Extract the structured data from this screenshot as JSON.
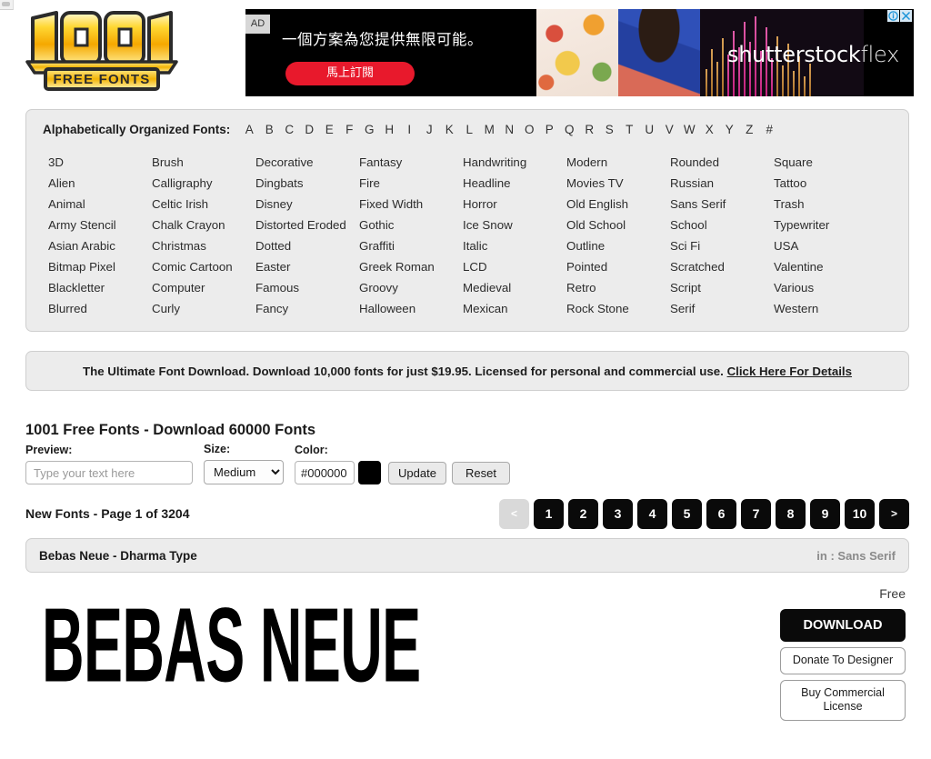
{
  "site": {
    "logo_top": "1001",
    "logo_bottom": "FREE FONTS"
  },
  "ad": {
    "tag": "AD",
    "headline": "一個方案為您提供無限可能。",
    "cta": "馬上訂閱",
    "brand": "shutterstock",
    "brand_suffix": "flex",
    "info_icon": "ⓘ",
    "close_icon": "✕"
  },
  "alphabet": {
    "label": "Alphabetically Organized Fonts:",
    "letters": [
      "A",
      "B",
      "C",
      "D",
      "E",
      "F",
      "G",
      "H",
      "I",
      "J",
      "K",
      "L",
      "M",
      "N",
      "O",
      "P",
      "Q",
      "R",
      "S",
      "T",
      "U",
      "V",
      "W",
      "X",
      "Y",
      "Z",
      "#"
    ]
  },
  "categories": [
    "3D",
    "Alien",
    "Animal",
    "Army Stencil",
    "Asian Arabic",
    "Bitmap Pixel",
    "Blackletter",
    "Blurred",
    "Brush",
    "Calligraphy",
    "Celtic Irish",
    "Chalk Crayon",
    "Christmas",
    "Comic Cartoon",
    "Computer",
    "Curly",
    "Decorative",
    "Dingbats",
    "Disney",
    "Distorted Eroded",
    "Dotted",
    "Easter",
    "Famous",
    "Fancy",
    "Fantasy",
    "Fire",
    "Fixed Width",
    "Gothic",
    "Graffiti",
    "Greek Roman",
    "Groovy",
    "Halloween",
    "Handwriting",
    "Headline",
    "Horror",
    "Ice Snow",
    "Italic",
    "LCD",
    "Medieval",
    "Mexican",
    "Modern",
    "Movies TV",
    "Old English",
    "Old School",
    "Outline",
    "Pointed",
    "Retro",
    "Rock Stone",
    "Rounded",
    "Russian",
    "Sans Serif",
    "School",
    "Sci Fi",
    "Scratched",
    "Script",
    "Serif",
    "Square",
    "Tattoo",
    "Trash",
    "Typewriter",
    "USA",
    "Valentine",
    "Various",
    "Western"
  ],
  "promo": {
    "text": "The Ultimate Font Download. Download 10,000 fonts for just $19.95. Licensed for personal and commercial use.",
    "link": "Click Here For Details"
  },
  "main": {
    "title": "1001 Free Fonts - Download 60000 Fonts",
    "preview_label": "Preview:",
    "preview_placeholder": "Type your text here",
    "preview_value": "",
    "size_label": "Size:",
    "size_value": "Medium",
    "size_options": [
      "Medium"
    ],
    "color_label": "Color:",
    "color_value": "#000000",
    "swatch_color": "#000000",
    "update_label": "Update",
    "reset_label": "Reset"
  },
  "pagination": {
    "status": "New Fonts - Page 1 of 3204",
    "prev": "<",
    "next": ">",
    "pages": [
      "1",
      "2",
      "3",
      "4",
      "5",
      "6",
      "7",
      "8",
      "9",
      "10"
    ],
    "current": "1"
  },
  "font_entry": {
    "name": "Bebas Neue - Dharma Type",
    "category": "in : Sans Serif",
    "price": "Free",
    "sample_text": "BEBAS NEUE",
    "download_label": "DOWNLOAD",
    "donate_label": "Donate To Designer",
    "license_label": "Buy Commercial License"
  }
}
